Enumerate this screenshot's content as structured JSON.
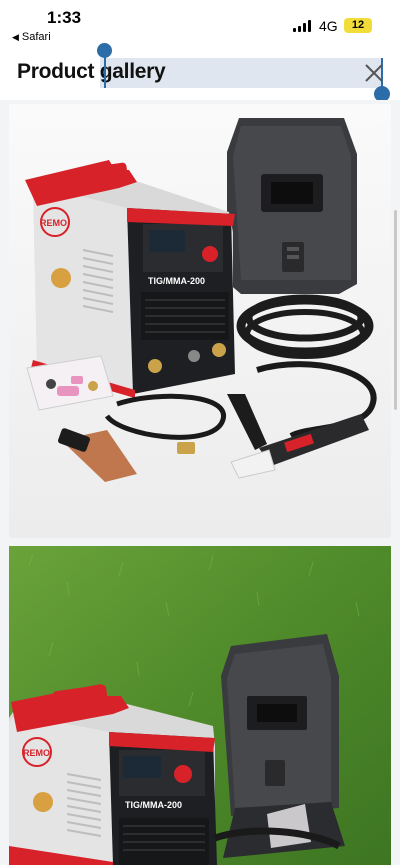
{
  "status_bar": {
    "time": "1:33",
    "back_app": "Safari",
    "network": "4G",
    "battery": "12"
  },
  "header": {
    "title": "Product gallery"
  },
  "gallery": {
    "images": [
      {
        "name": "welder-product-photo-1"
      },
      {
        "name": "welder-product-photo-2"
      }
    ],
    "model_label": "TIG/MMA-200",
    "brand": "REMO"
  },
  "colors": {
    "accent": "#2c6ca8",
    "selection": "#dfe6ef",
    "brand_red": "#d8222a",
    "battery": "#f2dc3a"
  }
}
